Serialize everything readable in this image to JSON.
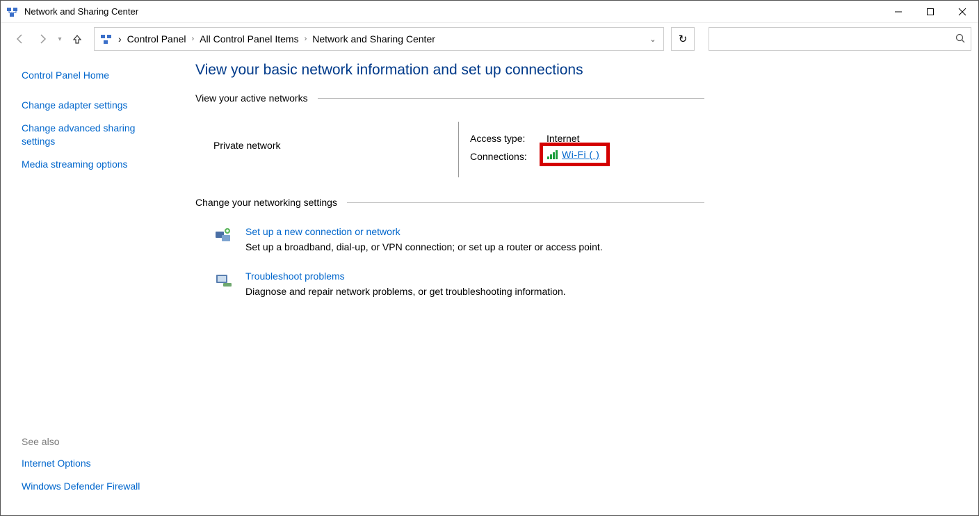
{
  "window": {
    "title": "Network and Sharing Center"
  },
  "breadcrumb": {
    "items": [
      "Control Panel",
      "All Control Panel Items",
      "Network and Sharing Center"
    ]
  },
  "search": {
    "placeholder": ""
  },
  "sidebar": {
    "links": [
      "Control Panel Home",
      "Change adapter settings",
      "Change advanced sharing settings",
      "Media streaming options"
    ],
    "see_also_label": "See also",
    "see_also": [
      "Internet Options",
      "Windows Defender Firewall"
    ]
  },
  "main": {
    "title": "View your basic network information and set up connections",
    "active_networks_header": "View your active networks",
    "network": {
      "type_label": "Private network",
      "access_label": "Access type:",
      "access_value": "Internet",
      "connections_label": "Connections:",
      "connection_link": "Wi-Fi (                    )"
    },
    "change_settings_header": "Change your networking settings",
    "setup": {
      "link": "Set up a new connection or network",
      "desc": "Set up a broadband, dial-up, or VPN connection; or set up a router or access point."
    },
    "troubleshoot": {
      "link": "Troubleshoot problems",
      "desc": "Diagnose and repair network problems, or get troubleshooting information."
    }
  }
}
